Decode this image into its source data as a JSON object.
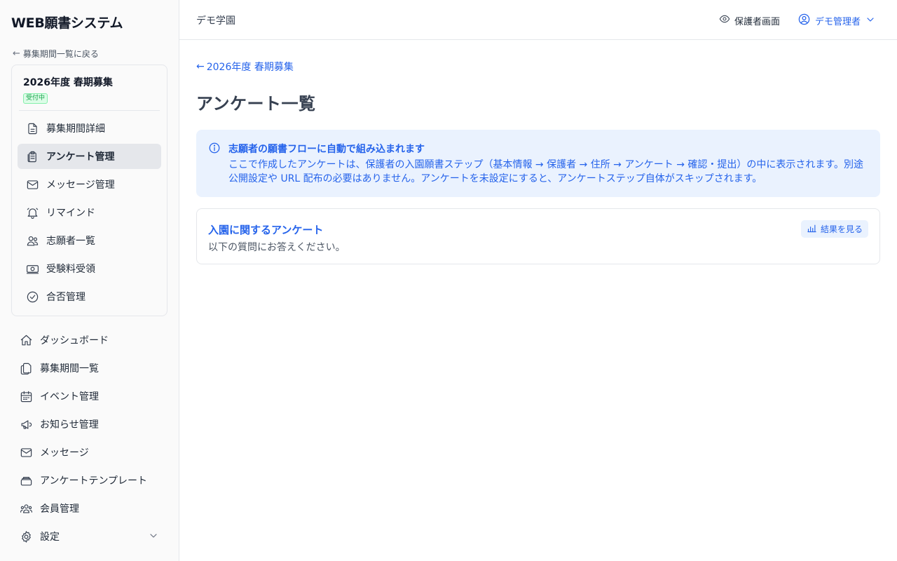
{
  "app": {
    "title": "WEB願書システム"
  },
  "sidebar": {
    "back_link": "募集期間一覧に戻る",
    "period": {
      "name": "2026年度 春期募集",
      "status": "受付中"
    },
    "sub_items": [
      {
        "label": "募集期間詳細",
        "icon": "document-icon"
      },
      {
        "label": "アンケート管理",
        "icon": "clipboard-icon",
        "active": true
      },
      {
        "label": "メッセージ管理",
        "icon": "mail-icon"
      },
      {
        "label": "リマインド",
        "icon": "bell-icon"
      },
      {
        "label": "志願者一覧",
        "icon": "users-icon"
      },
      {
        "label": "受験料受領",
        "icon": "banknote-icon"
      },
      {
        "label": "合否管理",
        "icon": "check-circle-icon"
      }
    ],
    "nav_items": [
      {
        "label": "ダッシュボード",
        "icon": "home-icon"
      },
      {
        "label": "募集期間一覧",
        "icon": "copy-icon"
      },
      {
        "label": "イベント管理",
        "icon": "calendar-icon"
      },
      {
        "label": "お知らせ管理",
        "icon": "megaphone-icon"
      },
      {
        "label": "メッセージ",
        "icon": "mail-icon"
      },
      {
        "label": "アンケートテンプレート",
        "icon": "stack-icon"
      },
      {
        "label": "会員管理",
        "icon": "user-group-icon"
      },
      {
        "label": "設定",
        "icon": "gear-icon"
      }
    ]
  },
  "header": {
    "school_name": "デモ学園",
    "guardian_view": "保護者画面",
    "user_name": "デモ管理者"
  },
  "main": {
    "back_link": "2026年度 春期募集",
    "title": "アンケート一覧",
    "info": {
      "title": "志願者の願書フローに自動で組み込まれます",
      "body": "ここで作成したアンケートは、保護者の入園願書ステップ（基本情報 → 保護者 → 住所 → アンケート → 確認・提出）の中に表示されます。別途公開設定や URL 配布の必要はありません。アンケートを未設定にすると、アンケートステップ自体がスキップされます。"
    },
    "survey": {
      "title": "入園に関するアンケート",
      "description": "以下の質問にお答えください。",
      "results_button": "結果を見る"
    }
  },
  "colors": {
    "accent": "#2563eb",
    "info_bg": "#eaf2fe",
    "active_bg": "#e5e7eb",
    "badge_green": "#16a34a"
  }
}
